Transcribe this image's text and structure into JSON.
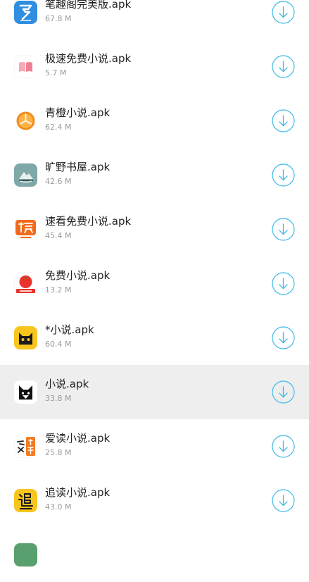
{
  "accent_color": "#3dbbe8",
  "items": [
    {
      "name": "笔趣阁完美版.apk",
      "size": "67.8 M",
      "icon": "pen-app-icon",
      "highlighted": false
    },
    {
      "name": "极速免费小说.apk",
      "size": "5.7 M",
      "icon": "open-book-app-icon",
      "highlighted": false
    },
    {
      "name": "青橙小说.apk",
      "size": "62.4 M",
      "icon": "orange-slice-app-icon",
      "highlighted": false
    },
    {
      "name": "旷野书屋.apk",
      "size": "42.6 M",
      "icon": "mountain-book-app-icon",
      "highlighted": false
    },
    {
      "name": "速看免费小说.apk",
      "size": "45.4 M",
      "icon": "sukan-app-icon",
      "highlighted": false
    },
    {
      "name": "免费小说.apk",
      "size": "13.2 M",
      "icon": "tomato-app-icon",
      "highlighted": false
    },
    {
      "name": "*小说.apk",
      "size": "60.4 M",
      "icon": "cat-yellow-app-icon",
      "highlighted": false
    },
    {
      "name": "小说.apk",
      "size": "33.8 M",
      "icon": "cat-black-app-icon",
      "highlighted": true
    },
    {
      "name": "爱读小说.apk",
      "size": "25.8 M",
      "icon": "aidu-app-icon",
      "highlighted": false
    },
    {
      "name": "追读小说.apk",
      "size": "43.0 M",
      "icon": "zhuidu-app-icon",
      "highlighted": false
    },
    {
      "name": "",
      "size": "",
      "icon": "partial-app-icon",
      "highlighted": false
    }
  ]
}
